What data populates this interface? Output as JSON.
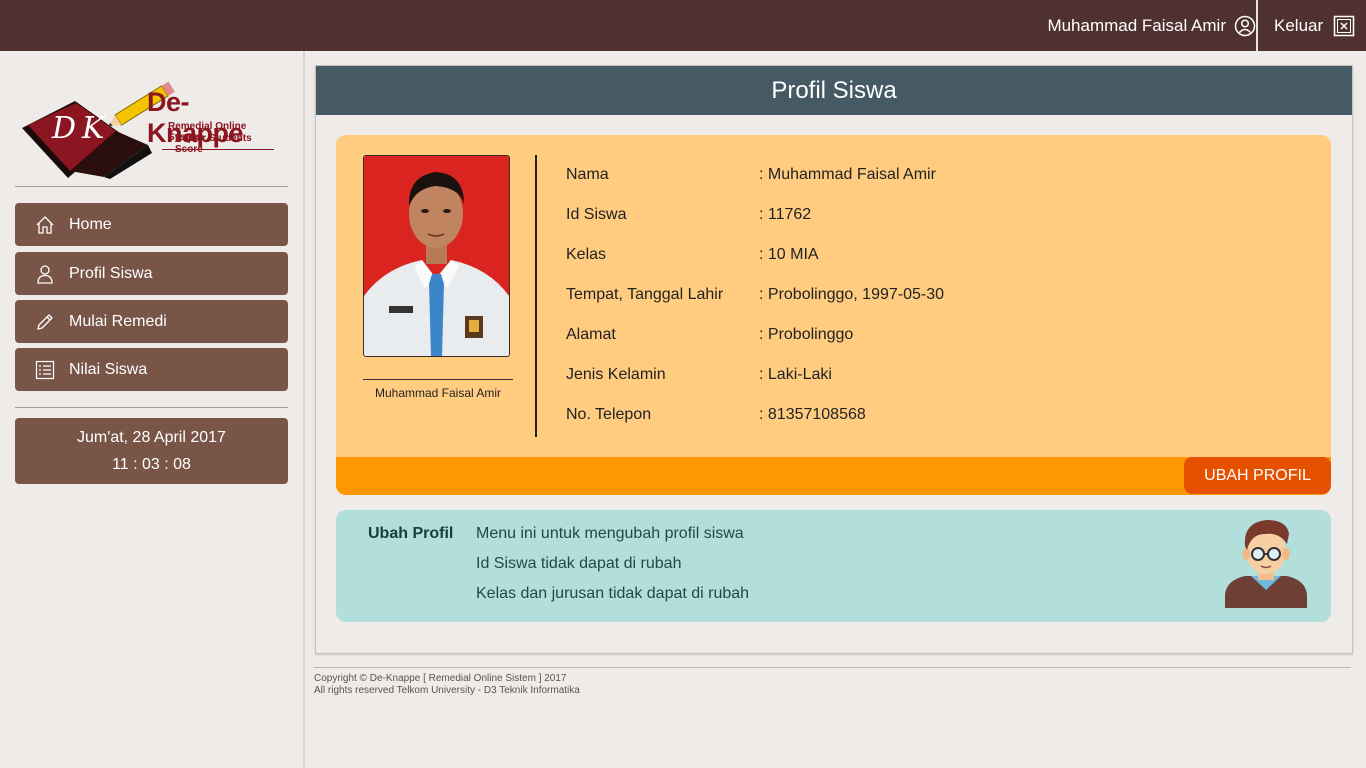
{
  "topbar": {
    "user_name": "Muhammad Faisal Amir",
    "user_icon": "user-circle-icon",
    "logout_label": "Keluar",
    "logout_icon": "logout-box-icon"
  },
  "logo": {
    "title": "De-Knappe",
    "subtitle1": "Remedial Online System",
    "subtitle2": "Repair Students Score",
    "monogram": "DK"
  },
  "sidebar": {
    "items": [
      {
        "label": "Home",
        "icon": "home-icon"
      },
      {
        "label": "Profil Siswa",
        "icon": "user-icon"
      },
      {
        "label": "Mulai Remedi",
        "icon": "pencil-icon"
      },
      {
        "label": "Nilai Siswa",
        "icon": "list-icon"
      }
    ],
    "date": "Jum'at, 28 April 2017",
    "time": "11 : 03 : 08"
  },
  "panel": {
    "title": "Profil Siswa"
  },
  "profile": {
    "photo_caption": "Muhammad Faisal Amir",
    "fields": [
      {
        "label": "Nama",
        "value": ": Muhammad Faisal Amir"
      },
      {
        "label": "Id Siswa",
        "value": ": 11762"
      },
      {
        "label": "Kelas",
        "value": ": 10 MIA"
      },
      {
        "label": "Tempat, Tanggal Lahir",
        "value": ": Probolinggo, 1997-05-30"
      },
      {
        "label": "Alamat",
        "value": ": Probolinggo"
      },
      {
        "label": "Jenis Kelamin",
        "value": ": Laki-Laki"
      },
      {
        "label": "No. Telepon",
        "value": ": 81357108568"
      }
    ],
    "edit_button": "UBAH PROFIL"
  },
  "help": {
    "title": "Ubah Profil",
    "lines": [
      "Menu ini untuk mengubah profil siswa",
      "Id Siswa tidak dapat di rubah",
      "Kelas dan jurusan tidak dapat di rubah"
    ]
  },
  "footer": {
    "line1": "Copyright © De-Knappe [ Remedial Online Sistem ] 2017",
    "line2": "All rights reserved Telkom University - D3 Teknik Informatika"
  },
  "colors": {
    "topbar": "#4f3230",
    "nav_button": "#795548",
    "panel_header": "#455a64",
    "profile_card": "#ffcc80",
    "orange_bar": "#ff9800",
    "edit_button": "#e65100",
    "help_card": "#b2dfdb"
  }
}
